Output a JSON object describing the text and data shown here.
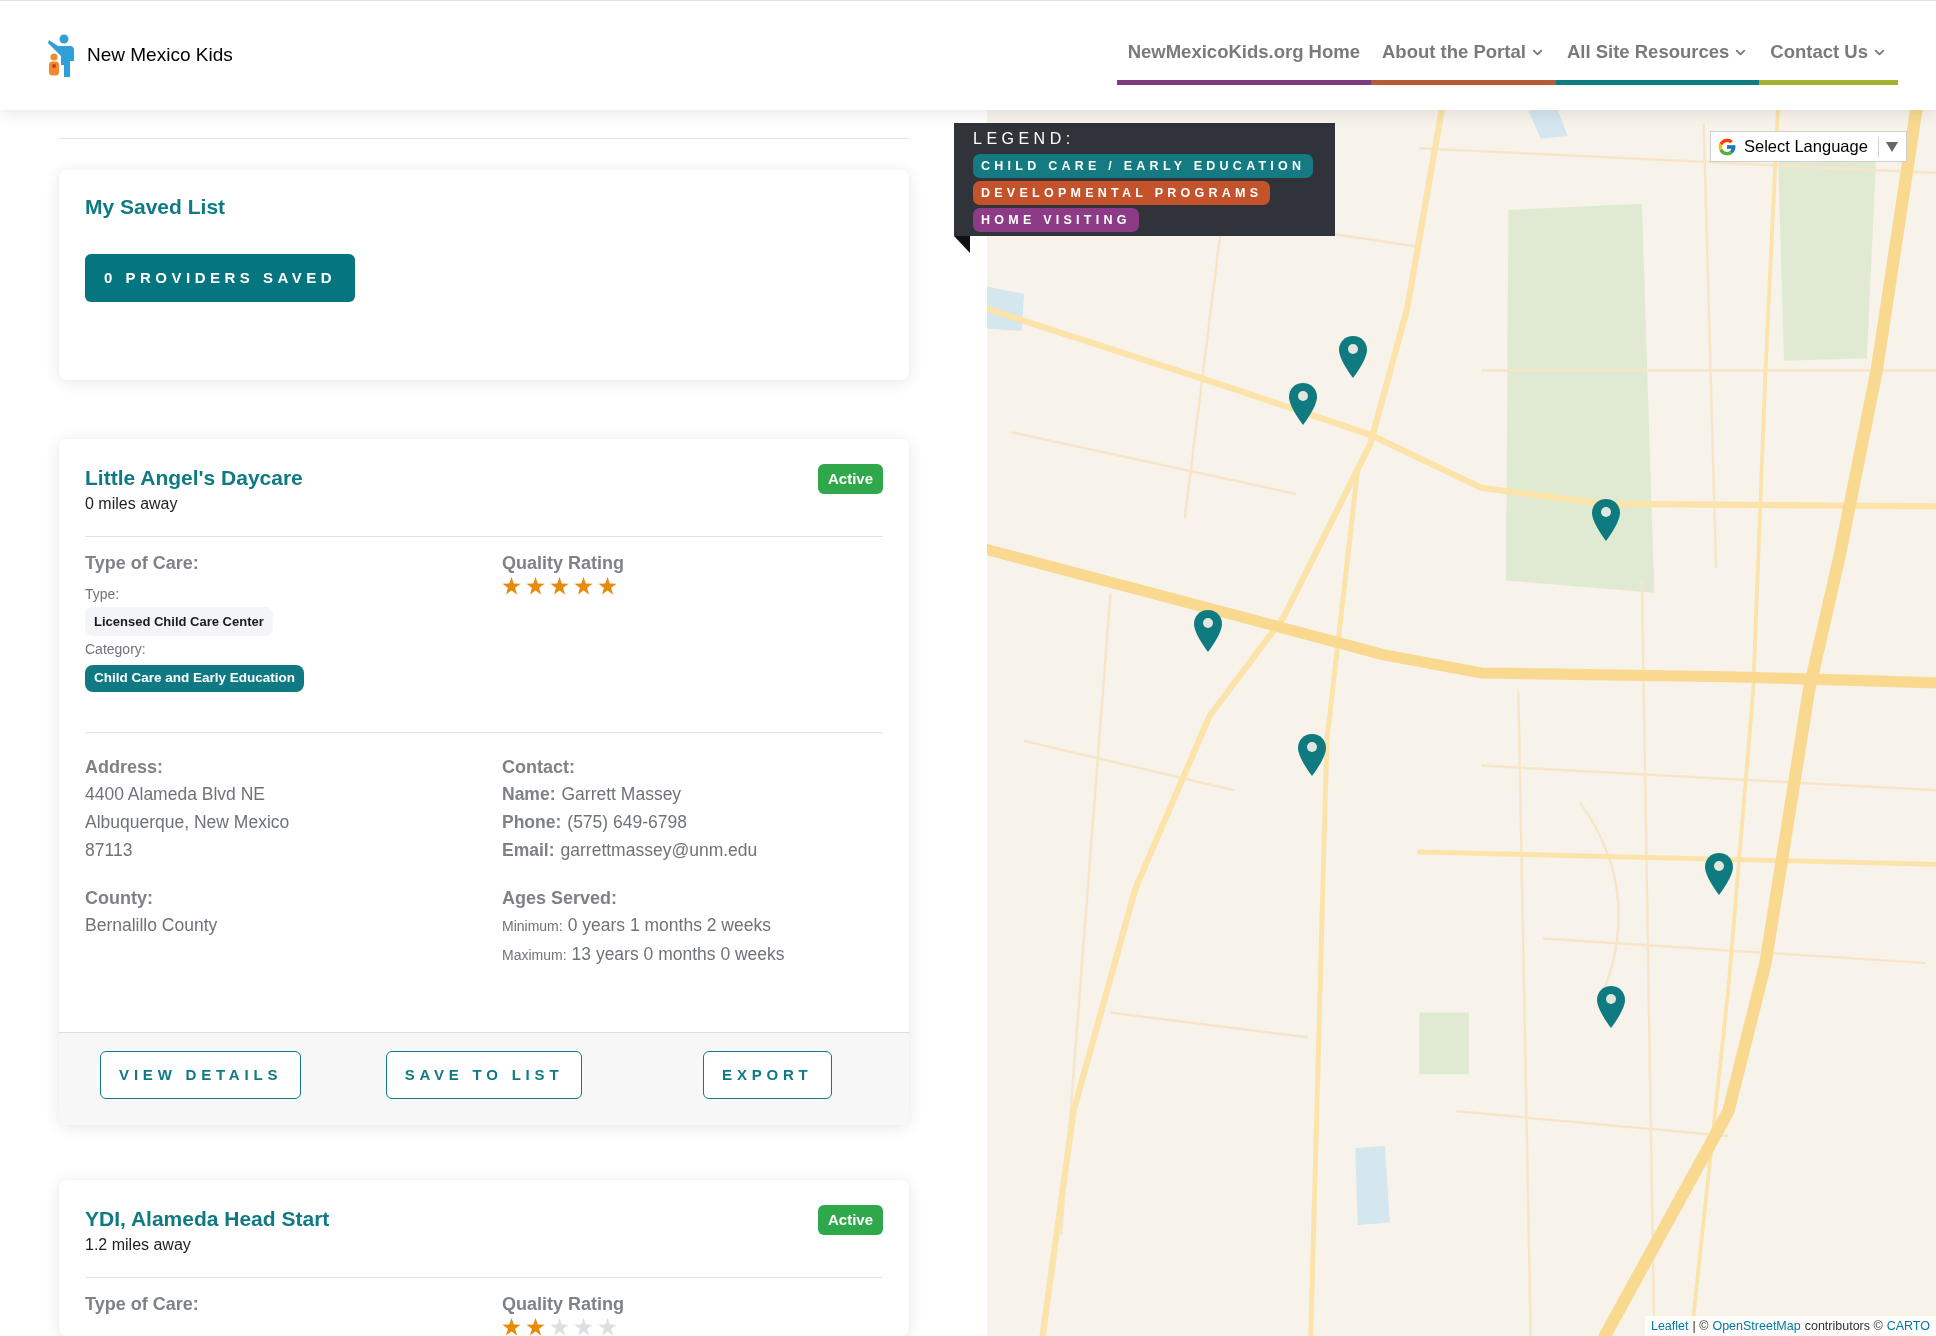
{
  "header": {
    "logo_text": "New Mexico Kids",
    "nav": [
      {
        "label": "NewMexicoKids.org Home",
        "dropdown": false,
        "color": "#7f3b7f"
      },
      {
        "label": "About the Portal",
        "dropdown": true,
        "color": "#b45a34"
      },
      {
        "label": "All Site Resources",
        "dropdown": true,
        "color": "#0f7b82"
      },
      {
        "label": "Contact Us",
        "dropdown": true,
        "color": "#a7b02f"
      }
    ]
  },
  "saved_list": {
    "title": "My Saved List",
    "button": "0 PROVIDERS SAVED"
  },
  "providers": [
    {
      "name": "Little Angel's Daycare",
      "distance": "0 miles away",
      "status": "Active",
      "type_of_care": {
        "heading": "Type of Care:",
        "type_label": "Type:",
        "type": "Licensed Child Care Center",
        "category_label": "Category:",
        "category": "Child Care and Early Education"
      },
      "quality": {
        "heading": "Quality Rating",
        "stars": 5
      },
      "address": {
        "heading": "Address:",
        "lines": [
          "4400 Alameda Blvd NE",
          "Albuquerque, New Mexico",
          "87113"
        ]
      },
      "county": {
        "heading": "County:",
        "value": "Bernalillo County"
      },
      "contact": {
        "heading": "Contact:",
        "fields": [
          {
            "label": "Name:",
            "value": "Garrett Massey"
          },
          {
            "label": "Phone:",
            "value": "(575) 649-6798"
          },
          {
            "label": "Email:",
            "value": "garrettmassey@unm.edu"
          }
        ]
      },
      "ages": {
        "heading": "Ages Served:",
        "fields": [
          {
            "label": "Minimum:",
            "value": "0 years 1 months 2 weeks"
          },
          {
            "label": "Maximum:",
            "value": "13 years 0 months 0 weeks"
          }
        ]
      },
      "actions": [
        "VIEW DETAILS",
        "SAVE TO LIST",
        "EXPORT"
      ]
    },
    {
      "name": "YDI, Alameda Head Start",
      "distance": "1.2 miles away",
      "status": "Active",
      "type_of_care": {
        "heading": "Type of Care:"
      },
      "quality": {
        "heading": "Quality Rating",
        "stars": 2
      }
    }
  ],
  "map": {
    "legend": {
      "title": "LEGEND:",
      "items": [
        {
          "label": "CHILD CARE / EARLY EDUCATION",
          "color": "#137b81"
        },
        {
          "label": "DEVELOPMENTAL PROGRAMS",
          "color": "#c4532c"
        },
        {
          "label": "HOME VISITING",
          "color": "#8e3b87"
        }
      ]
    },
    "language": {
      "label": "Select Language"
    },
    "attribution": [
      {
        "kind": "link",
        "text": "Leaflet"
      },
      {
        "kind": "text",
        "text": "| ©"
      },
      {
        "kind": "link",
        "text": "OpenStreetMap"
      },
      {
        "kind": "text",
        "text": "contributors ©"
      },
      {
        "kind": "link",
        "text": "CARTO"
      }
    ]
  }
}
